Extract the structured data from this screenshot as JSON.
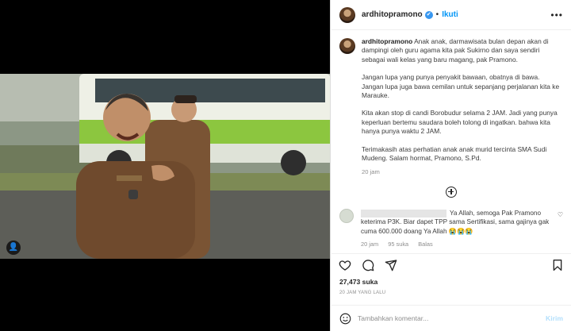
{
  "post": {
    "username": "ardhitopramono",
    "follow_label": "Ikuti",
    "verified_mark": "✔",
    "more_label": "•••",
    "caption": [
      "Anak anak, darmawisata bulan depan akan di dampingi oleh guru agama kita pak Sukirno dan saya sendiri sebagai wali kelas yang baru magang, pak Pramono.",
      "Jangan lupa yang punya penyakit bawaan, obatnya di bawa. Jangan lupa juga bawa cemilan untuk sepanjang perjalanan kita ke Marauke.",
      "Kita akan stop di candi Borobudur selama 2 JAM. Jadi yang punya keperluan bertemu saudara boleh tolong di ingatkan. bahwa kita hanya punya waktu 2 JAM.",
      "Terimakasih atas perhatian anak anak murid tercinta SMA Sudi Mudeng. Salam hormat, Pramono, S.Pd."
    ],
    "caption_time": "20 jam",
    "likes": "27,473 suka",
    "posted_ago": "20 JAM YANG LALU"
  },
  "comment": {
    "text": "Ya Allah, semoga Pak Pramono keterima P3K. Biar dapet TPP sama Sertifikasi, sama gajinya gak cuma 600.000 doang Ya Allah 😭😭😭",
    "time": "20 jam",
    "likes": "95 suka",
    "reply_label": "Balas"
  },
  "composer": {
    "placeholder": "Tambahkan komentar...",
    "post_label": "Kirim"
  },
  "colors": {
    "accent": "#0095f6",
    "verified": "#3897f0",
    "muted": "#8e8e8e"
  },
  "icons": [
    "heart-icon",
    "comment-icon",
    "share-icon",
    "save-icon",
    "emoji-icon",
    "add-comments-icon",
    "tag-user-icon",
    "more-options-icon"
  ]
}
